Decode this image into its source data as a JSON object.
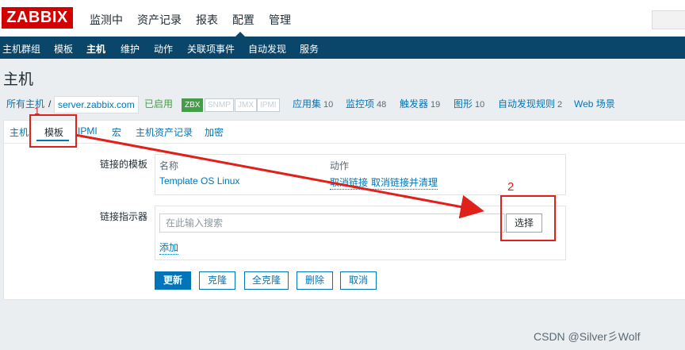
{
  "header": {
    "logo": "ZABBIX",
    "nav": [
      "监测中",
      "资产记录",
      "报表",
      "配置",
      "管理"
    ],
    "active_nav": "配置"
  },
  "subnav": [
    "主机群组",
    "模板",
    "主机",
    "维护",
    "动作",
    "关联项事件",
    "自动发现",
    "服务"
  ],
  "page_title": "主机",
  "breadcrumb": {
    "all_hosts": "所有主机",
    "separator": "/",
    "host": "server.zabbix.com",
    "status": "已启用",
    "availability": [
      "ZBX",
      "SNMP",
      "JMX",
      "IPMI"
    ],
    "links": [
      {
        "label": "应用集",
        "count": "10"
      },
      {
        "label": "监控项",
        "count": "48"
      },
      {
        "label": "触发器",
        "count": "19"
      },
      {
        "label": "图形",
        "count": "10"
      },
      {
        "label": "自动发现规则",
        "count": "2"
      },
      {
        "label": "Web 场景",
        "count": ""
      }
    ]
  },
  "tabs": [
    "主机",
    "模板",
    "IPMI",
    "宏",
    "主机资产记录",
    "加密"
  ],
  "active_tab": "模板",
  "form": {
    "linked_templates_label": "链接的模板",
    "col_name": "名称",
    "col_action": "动作",
    "template_name": "Template OS Linux",
    "unlink": "取消链接",
    "unlink_clear": "取消链接并清理",
    "link_indicator_label": "链接指示器",
    "search_placeholder": "在此输入搜索",
    "select_button": "选择",
    "add_link": "添加"
  },
  "buttons": {
    "update": "更新",
    "clone": "克隆",
    "full_clone": "全克隆",
    "delete": "删除",
    "cancel": "取消"
  },
  "annotations": {
    "step1": "1",
    "step2": "2",
    "box_color": "#e0201b"
  },
  "watermark": "CSDN @Silver彡Wolf",
  "colors": {
    "brand": "#d40000",
    "nav_bg": "#0a466a",
    "link": "#0275b8",
    "enabled": "#429e47"
  }
}
